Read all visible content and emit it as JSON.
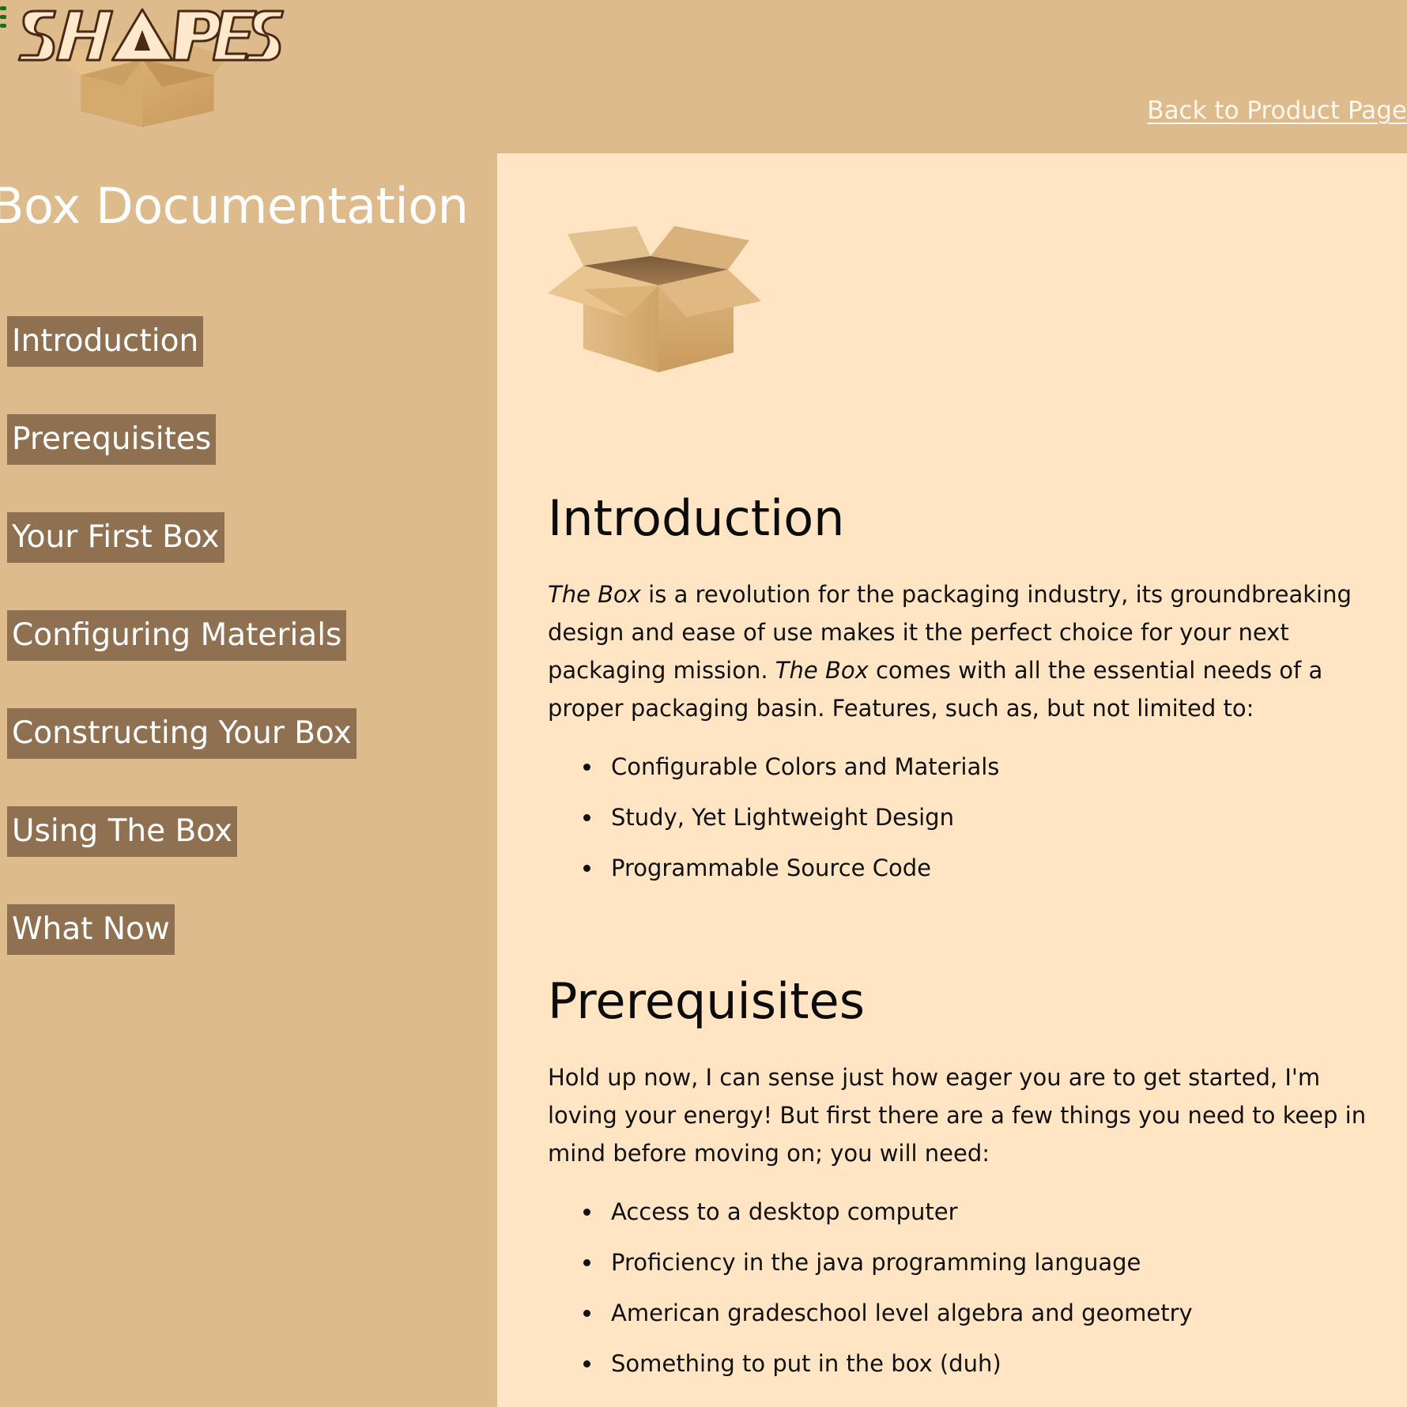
{
  "header": {
    "logo_text": "SHAPES",
    "back_link": "Back to Product Page"
  },
  "sidebar": {
    "title": "Box Documentation",
    "items": [
      {
        "label": "Introduction"
      },
      {
        "label": "Prerequisites"
      },
      {
        "label": "Your First Box"
      },
      {
        "label": "Configuring Materials"
      },
      {
        "label": "Constructing Your Box"
      },
      {
        "label": "Using The Box"
      },
      {
        "label": "What Now"
      }
    ]
  },
  "main": {
    "intro": {
      "title": "Introduction",
      "p_em1": "The Box",
      "p_text1": " is a revolution for the packaging industry, its groundbreaking design and ease of use makes it the perfect choice for your next packaging mission. ",
      "p_em2": "The Box",
      "p_text2": " comes with all the essential needs of a proper packaging basin. Features, such as, but not limited to:",
      "bullets": [
        "Configurable Colors and Materials",
        "Study, Yet Lightweight Design",
        "Programmable Source Code"
      ]
    },
    "prereq": {
      "title": "Prerequisites",
      "paragraph": "Hold up now, I can sense just how eager you are to get started, I'm loving your energy! But first there are a few things you need to keep in mind before moving on; you will need:",
      "bullets": [
        "Access to a desktop computer",
        "Proficiency in the java programming language",
        "American gradeschool level algebra and geometry",
        "Something to put in the box (duh)"
      ]
    }
  },
  "colors": {
    "page_bg": "#debb8c",
    "content_bg": "#ffe5c4",
    "nav_item_bg": "#8f7050",
    "text_light": "#ffffff",
    "text_dark": "#111111"
  },
  "icons": [
    "menu-icon",
    "box-logo-icon",
    "open-box-icon"
  ]
}
